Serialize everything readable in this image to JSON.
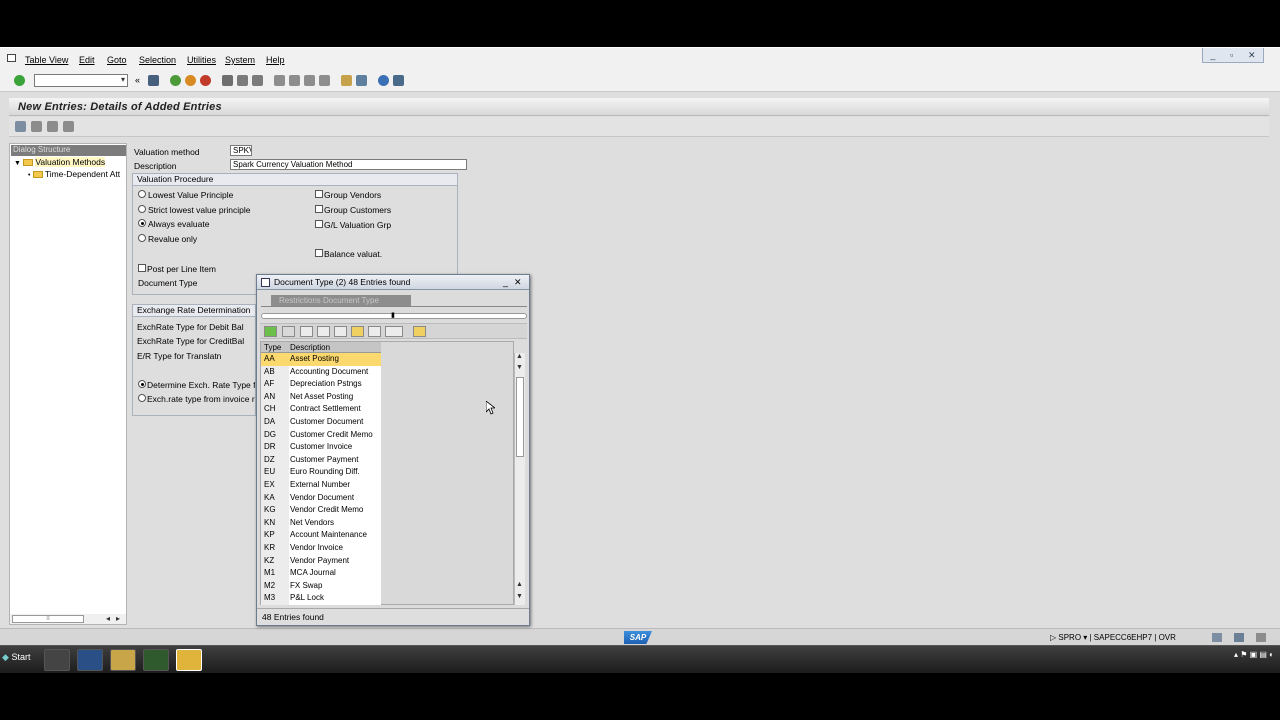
{
  "menu": {
    "items": [
      "Table View",
      "Edit",
      "Goto",
      "Selection",
      "Utilities",
      "System",
      "Help"
    ]
  },
  "window_controls": [
    "_",
    "▫",
    "✕"
  ],
  "screen_title": "New Entries: Details of Added Entries",
  "tree": {
    "header": "Dialog Structure",
    "items": [
      "Valuation Methods",
      "Time-Dependent Att"
    ]
  },
  "form": {
    "valuation_method_label": "Valuation method",
    "valuation_method_value": "SPKV",
    "description_label": "Description",
    "description_value": "Spark Currency Valuation Method",
    "procedure_group_title": "Valuation Procedure",
    "radios": [
      {
        "label": "Lowest Value Principle",
        "selected": false
      },
      {
        "label": "Strict lowest value principle",
        "selected": false
      },
      {
        "label": "Always evaluate",
        "selected": true
      },
      {
        "label": "Revalue only",
        "selected": false
      }
    ],
    "checkboxes_right": [
      "Group Vendors",
      "Group Customers",
      "G/L Valuation Grp",
      "Balance valuat."
    ],
    "post_per_line_item": "Post per Line Item",
    "document_type_label": "Document Type",
    "exchange_group_title": "Exchange Rate Determination",
    "exch_debit": "ExchRate Type for Debit Bal",
    "exch_credit": "ExchRate Type for CreditBal",
    "er_translatn": "E/R Type for Translatn",
    "determine_radio": "Determine Exch. Rate Type f",
    "from_invoice_radio": "Exch.rate type from invoice re"
  },
  "popup": {
    "title": "Document Type (2)   48 Entries found",
    "tab_label": "Restrictions Document Type",
    "columns": [
      "Type",
      "Description"
    ],
    "rows": [
      [
        "AA",
        "Asset Posting"
      ],
      [
        "AB",
        "Accounting Document"
      ],
      [
        "AF",
        "Depreciation Pstngs"
      ],
      [
        "AN",
        "Net Asset Posting"
      ],
      [
        "CH",
        "Contract Settlement"
      ],
      [
        "DA",
        "Customer Document"
      ],
      [
        "DG",
        "Customer Credit Memo"
      ],
      [
        "DR",
        "Customer Invoice"
      ],
      [
        "DZ",
        "Customer Payment"
      ],
      [
        "EU",
        "Euro Rounding Diff."
      ],
      [
        "EX",
        "External Number"
      ],
      [
        "KA",
        "Vendor Document"
      ],
      [
        "KG",
        "Vendor Credit Memo"
      ],
      [
        "KN",
        "Net Vendors"
      ],
      [
        "KP",
        "Account Maintenance"
      ],
      [
        "KR",
        "Vendor Invoice"
      ],
      [
        "KZ",
        "Vendor Payment"
      ],
      [
        "M1",
        "MCA Journal"
      ],
      [
        "M2",
        "FX Swap"
      ],
      [
        "M3",
        "P&L Lock"
      ]
    ],
    "status": "48 Entries found"
  },
  "statusbar": {
    "logo": "SAP",
    "system_info": "SPRO ▾ | SAPECC6EHP7 | OVR"
  },
  "taskbar": {
    "start_label": "Start"
  }
}
